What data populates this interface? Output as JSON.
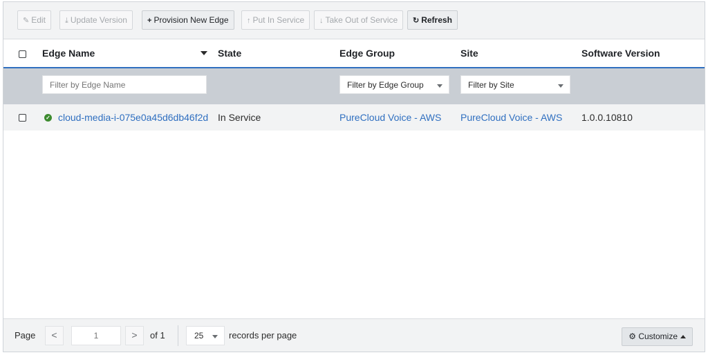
{
  "toolbar": {
    "edit": {
      "icon": "edit-icon",
      "glyph": "✎",
      "label": "Edit"
    },
    "update_version": {
      "icon": "download-icon",
      "glyph": "⤓",
      "label": "Update Version"
    },
    "provision": {
      "icon": "plus-icon",
      "glyph": "+",
      "label": "Provision New Edge"
    },
    "put_in_service": {
      "icon": "arrow-up-icon",
      "glyph": "↑",
      "label": "Put In Service"
    },
    "take_out": {
      "icon": "arrow-down-icon",
      "glyph": "↓",
      "label": "Take Out of Service"
    },
    "refresh": {
      "icon": "refresh-icon",
      "glyph": "↻",
      "label": "Refresh"
    }
  },
  "table": {
    "columns": [
      "Edge Name",
      "State",
      "Edge Group",
      "Site",
      "Software Version"
    ],
    "filters": {
      "edge_name_placeholder": "Filter by Edge Name",
      "edge_group": "Filter by Edge Group",
      "site": "Filter by Site"
    },
    "rows": [
      {
        "status_icon": "check-circle-icon",
        "edge_name": "cloud-media-i-075e0a45d6db46f2d",
        "state": "In Service",
        "edge_group": "PureCloud Voice - AWS",
        "site": "PureCloud Voice - AWS",
        "software_version": "1.0.0.10810"
      }
    ]
  },
  "footer": {
    "page_label": "Page",
    "prev": "<",
    "current_page_placeholder": "1",
    "next": ">",
    "of_label": "of 1",
    "per_page": "25",
    "records_label": "records per page",
    "customize_icon": "gear-icon",
    "customize_glyph": "⚙",
    "customize_label": "Customize"
  },
  "colors": {
    "accent": "#2f6fc0",
    "status_ok": "#3d8b2f",
    "filter_bar": "#c9ced4"
  }
}
